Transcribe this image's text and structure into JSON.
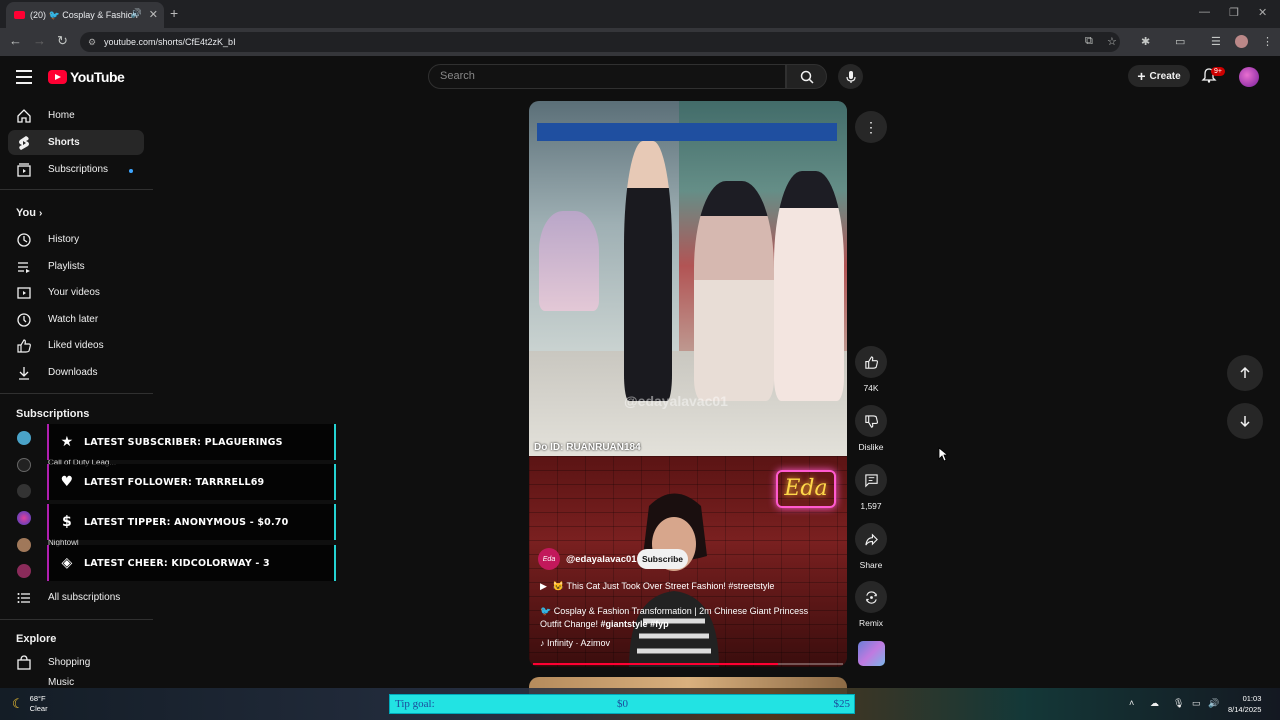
{
  "browser": {
    "tab_title": "(20) 🐦 Cosplay & Fashion",
    "tab_count_prefix": "(20)",
    "url": "youtube.com/shorts/CfE4t2zK_bI"
  },
  "header": {
    "logo_text": "YouTube",
    "search_placeholder": "Search",
    "create_label": "Create",
    "notification_badge": "9+"
  },
  "sidebar": {
    "main": [
      {
        "label": "Home",
        "icon": "home-icon"
      },
      {
        "label": "Shorts",
        "icon": "shorts-icon"
      },
      {
        "label": "Subscriptions",
        "icon": "subscriptions-icon"
      }
    ],
    "you_heading": "You",
    "you_items": [
      {
        "label": "History",
        "icon": "history-icon"
      },
      {
        "label": "Playlists",
        "icon": "playlists-icon"
      },
      {
        "label": "Your videos",
        "icon": "your-videos-icon"
      },
      {
        "label": "Watch later",
        "icon": "watch-later-icon"
      },
      {
        "label": "Liked videos",
        "icon": "liked-videos-icon"
      },
      {
        "label": "Downloads",
        "icon": "downloads-icon"
      }
    ],
    "subscriptions_heading": "Subscriptions",
    "subscription_peek_1": "Call of Duty Leag...",
    "subscription_peek_2": "Nightowl",
    "all_subscriptions": "All subscriptions",
    "explore_heading": "Explore",
    "explore_items": [
      {
        "label": "Shopping",
        "icon": "shopping-icon"
      },
      {
        "label": "Music",
        "icon": "music-icon"
      }
    ]
  },
  "alerts": [
    {
      "text": "LATEST SUBSCRIBER: PLAGUERINGS",
      "icon": "star-icon"
    },
    {
      "text": "LATEST FOLLOWER: TARRRELL69",
      "icon": "heart-icon"
    },
    {
      "text": "LATEST TIPPER: ANONYMOUS - $0.70",
      "icon": "dollar-icon"
    },
    {
      "text": "LATEST CHEER: KIDCOLORWAY - 3",
      "icon": "diamond-icon"
    }
  ],
  "short": {
    "watermark": "@edayalavac01",
    "douyin_id": "Do ID: RUANRUAN184",
    "neon_sign": "Eda",
    "channel_avatar_text": "Eda",
    "channel": "@edayalavac01",
    "subscribe_label": "Subscribe",
    "related_title": "😺 This Cat Just Took Over Street Fashion! #streetstyle",
    "caption_prefix": "🐦 Cosplay & Fashion Transformation | 2m Chinese Giant Princess Outfit Change! ",
    "caption_tags": "#giantstyle #fyp",
    "music": "Infinity · Azimov",
    "progress": 0.79
  },
  "actions": {
    "like_count": "74K",
    "dislike_label": "Dislike",
    "comment_count": "1,597",
    "share_label": "Share",
    "remix_label": "Remix"
  },
  "tip_goal": {
    "label": "Tip goal:",
    "current": "$0",
    "target": "$25"
  },
  "taskbar": {
    "temperature": "68°F",
    "condition": "Clear",
    "time": "01:03",
    "date": "8/14/2025"
  },
  "colors": {
    "brand_red": "#ff0033",
    "alert_left_border": "#b01fb0",
    "alert_right_border": "#24d3d3",
    "tip_goal_bg": "#22e3e3"
  }
}
